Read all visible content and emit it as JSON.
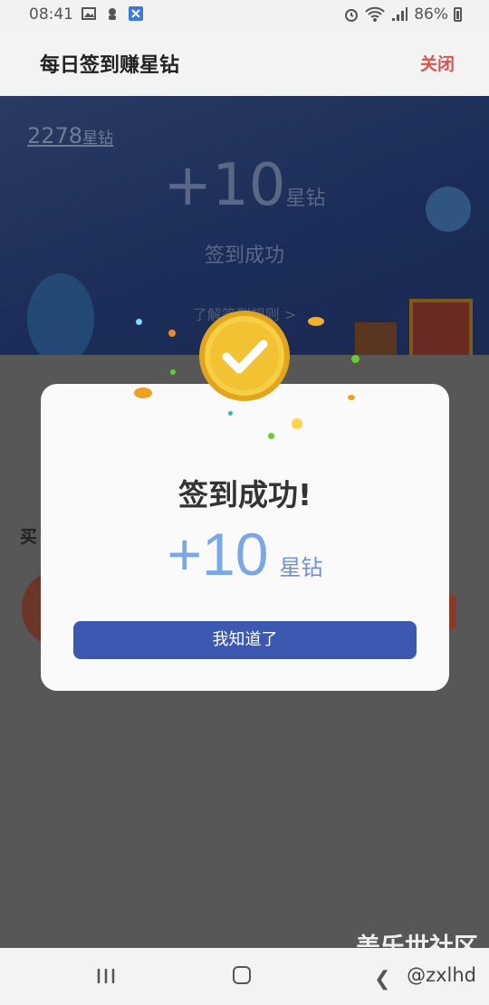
{
  "status_bar": {
    "time": "08:41",
    "battery": "86%",
    "icons": [
      "image-icon",
      "notification-icon",
      "app-icon",
      "alarm-icon",
      "wifi-icon",
      "signal-icon",
      "battery-icon"
    ]
  },
  "header": {
    "title": "每日签到赚星钻",
    "close_label": "关闭",
    "close_color": "#d9534f"
  },
  "banner": {
    "total_value": "2278",
    "total_unit": "星钻",
    "amount": "+10",
    "amount_unit": "星钻",
    "status": "签到成功",
    "rules_link": "了解签到规则 >"
  },
  "background": {
    "heading": "买"
  },
  "modal": {
    "title": "签到成功!",
    "amount": "+10",
    "unit": "星钻",
    "button_label": "我知道了",
    "button_color": "#3c58b0",
    "amount_color": "#7aa7e5"
  },
  "watermark": {
    "text": "盖乐世社区",
    "handle": "@zxlhd"
  },
  "nav": {
    "icons": [
      "recent-apps-icon",
      "home-icon",
      "back-icon"
    ]
  }
}
